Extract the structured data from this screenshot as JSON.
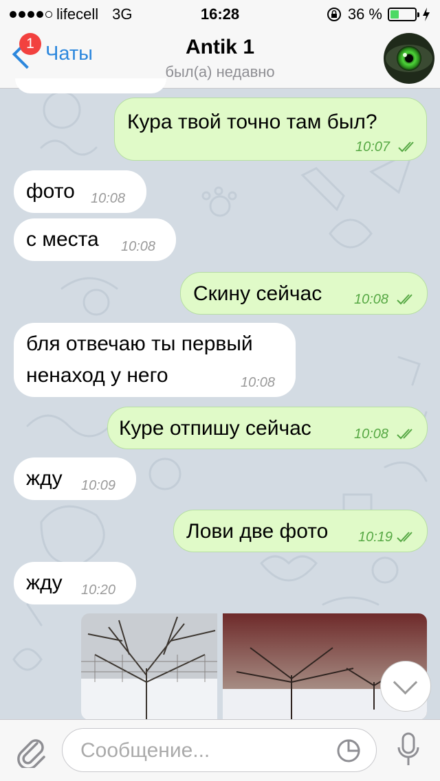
{
  "status": {
    "carrier": "lifecell",
    "network": "3G",
    "time": "16:28",
    "battery": "36 %",
    "battery_level": 0.36
  },
  "header": {
    "back_label": "Чаты",
    "badge": "1",
    "title": "Antik 1",
    "subtitle": "был(а) недавно"
  },
  "messages": [
    {
      "dir": "out",
      "text": "Кура твой точно там был?",
      "time": "10:07"
    },
    {
      "dir": "in",
      "text": "фото",
      "time": "10:08"
    },
    {
      "dir": "in",
      "text": "с места",
      "time": "10:08"
    },
    {
      "dir": "out",
      "text": "Скину сейчас",
      "time": "10:08"
    },
    {
      "dir": "in",
      "line1": "бля отвечаю ты первый",
      "line2": "ненаход у него",
      "time": "10:08"
    },
    {
      "dir": "out",
      "text": "Куре отпишу сейчас",
      "time": "10:08"
    },
    {
      "dir": "in",
      "text": "жду",
      "time": "10:09"
    },
    {
      "dir": "out",
      "text": "Лови две фото",
      "time": "10:19"
    },
    {
      "dir": "in",
      "text": "жду",
      "time": "10:20"
    }
  ],
  "input": {
    "placeholder": "Сообщение..."
  },
  "icons": {
    "attach": "paperclip-icon",
    "sticker": "sticker-icon",
    "mic": "microphone-icon",
    "scroll": "chevron-down-icon"
  },
  "colors": {
    "accent": "#2c87dd",
    "outgoing_bubble": "#e0fac8",
    "incoming_bubble": "#ffffff",
    "badge": "#f2413f",
    "read_check": "#56a844"
  }
}
